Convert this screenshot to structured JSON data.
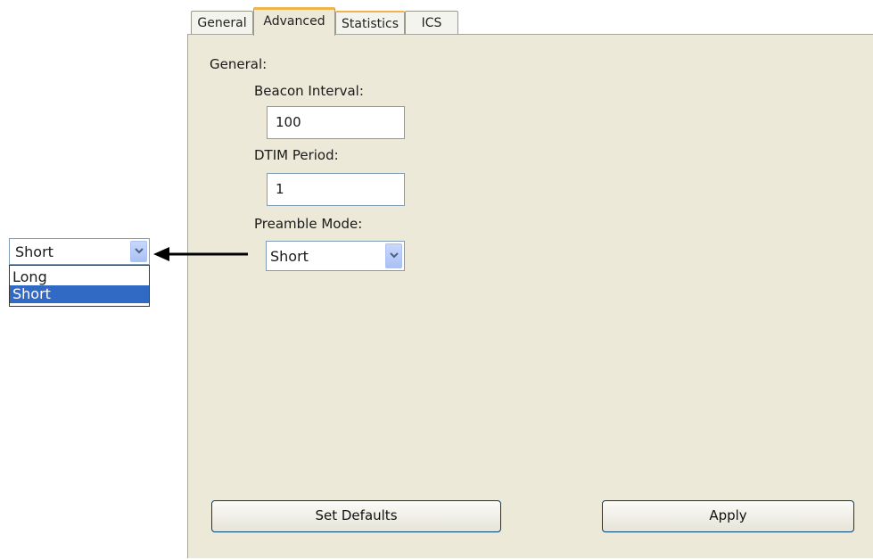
{
  "tabs": [
    {
      "label": "General"
    },
    {
      "label": "Advanced"
    },
    {
      "label": "Statistics"
    },
    {
      "label": "ICS"
    }
  ],
  "panel": {
    "group_label": "General:",
    "beacon_interval": {
      "label": "Beacon Interval:",
      "value": "100"
    },
    "dtim_period": {
      "label": "DTIM Period:",
      "value": "1"
    },
    "preamble_mode": {
      "label": "Preamble Mode:",
      "value": "Short"
    },
    "buttons": {
      "set_defaults": "Set Defaults",
      "apply": "Apply"
    }
  },
  "callout": {
    "selected_value": "Short",
    "options": [
      "Long",
      "Short"
    ],
    "highlighted_option": "Short"
  },
  "colors": {
    "panel_bg": "#ece9d8",
    "active_tab_accent": "#f2b34b",
    "selection": "#316ac5",
    "input_border": "#7f9db9"
  },
  "icons": [
    "chevron-down-icon",
    "arrow-left-icon"
  ]
}
